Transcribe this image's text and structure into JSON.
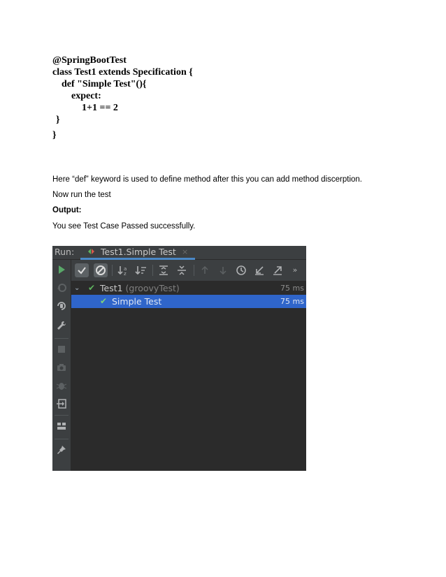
{
  "code": {
    "lines": [
      "@SpringBootTest",
      "class Test1 extends Specification {",
      "def \"Simple Test\"(){",
      "expect:",
      "1+1 == 2",
      "}",
      "}"
    ]
  },
  "text": {
    "para1": "Here “def” keyword is used to define method after this you can add method discerption.",
    "para2": "Now run the test",
    "output_label": "Output:",
    "para3": "You see Test Case Passed successfully."
  },
  "ide": {
    "run_label": "Run:",
    "tab_title": "Test1.Simple Test",
    "tab_close": "×",
    "toolbar_more": "»",
    "tree": [
      {
        "name": "Test1",
        "sub": " (groovyTest)",
        "time": "75 ms",
        "selected": false
      },
      {
        "name": "Simple Test",
        "sub": "",
        "time": "75 ms",
        "selected": true
      }
    ],
    "colors": {
      "panel_bg": "#3c3f41",
      "tree_bg": "#2b2b2b",
      "selection": "#2f65ca",
      "pass_green": "#5fb55f",
      "run_green": "#59a869",
      "tab_underline": "#4a88c7"
    }
  }
}
